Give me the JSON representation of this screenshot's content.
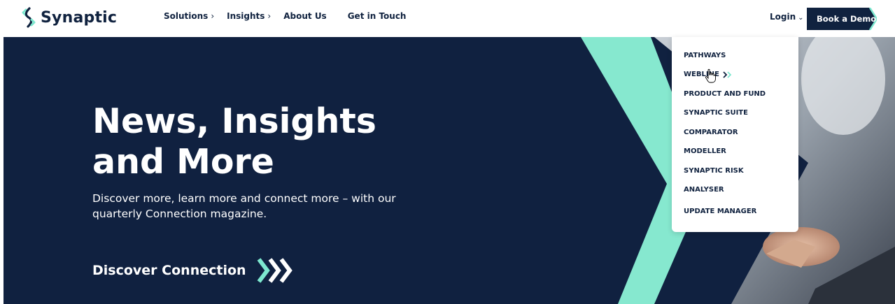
{
  "brand": {
    "name": "Synaptic",
    "accent_color": "#7de8cf",
    "navy_color": "#10223f"
  },
  "nav": {
    "items": [
      {
        "label": "Solutions",
        "has_caret": true,
        "caret": "›"
      },
      {
        "label": "Insights",
        "has_caret": true,
        "caret": "›"
      },
      {
        "label": "About Us",
        "has_caret": false
      },
      {
        "label": "Get in Touch",
        "has_caret": false
      }
    ],
    "login_label": "Login",
    "login_caret": "⌄",
    "demo_label": "Book a Demo"
  },
  "hero": {
    "title": "News, Insights and More",
    "subtitle": "Discover more, learn more and connect more – with our quarterly Connection magazine.",
    "cta_label": "Discover Connection",
    "cta_icon": "triple-chevron-right-icon"
  },
  "dropdown": {
    "items": [
      {
        "label": "PATHWAYS",
        "hovered": false
      },
      {
        "label": "WEBLINE",
        "hovered": true
      },
      {
        "label": "PRODUCT AND FUND",
        "hovered": false
      },
      {
        "label": "SYNAPTIC SUITE",
        "hovered": false
      },
      {
        "label": "COMPARATOR",
        "hovered": false
      },
      {
        "label": "MODELLER",
        "hovered": false
      },
      {
        "label": "SYNAPTIC RISK",
        "hovered": false
      },
      {
        "label": "ANALYSER",
        "hovered": false
      },
      {
        "label": "UPDATE MANAGER",
        "hovered": false
      }
    ]
  }
}
